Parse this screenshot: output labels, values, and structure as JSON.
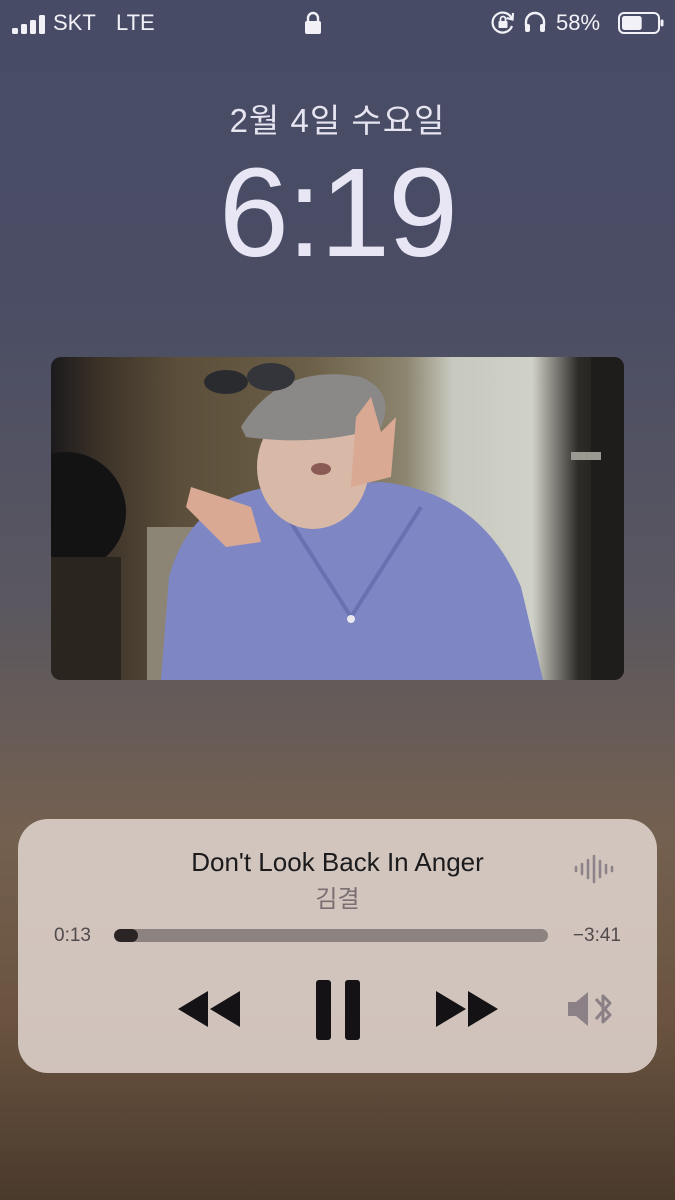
{
  "status_bar": {
    "carrier": "SKT",
    "network": "LTE",
    "battery_percent": "58%",
    "battery_level": 0.58,
    "icons": [
      "signal-icon",
      "lock-icon",
      "rotation-lock-icon",
      "headphones-icon",
      "battery-icon"
    ]
  },
  "lock_screen": {
    "date": "2월 4일 수요일",
    "time": "6:19"
  },
  "now_playing": {
    "title": "Don't Look Back In Anger",
    "artist": "김결",
    "elapsed": "0:13",
    "remaining": "−3:41",
    "progress": 0.055,
    "icons": [
      "waveform-icon",
      "rewind-icon",
      "pause-icon",
      "fast-forward-icon",
      "speaker-bluetooth-icon"
    ]
  }
}
